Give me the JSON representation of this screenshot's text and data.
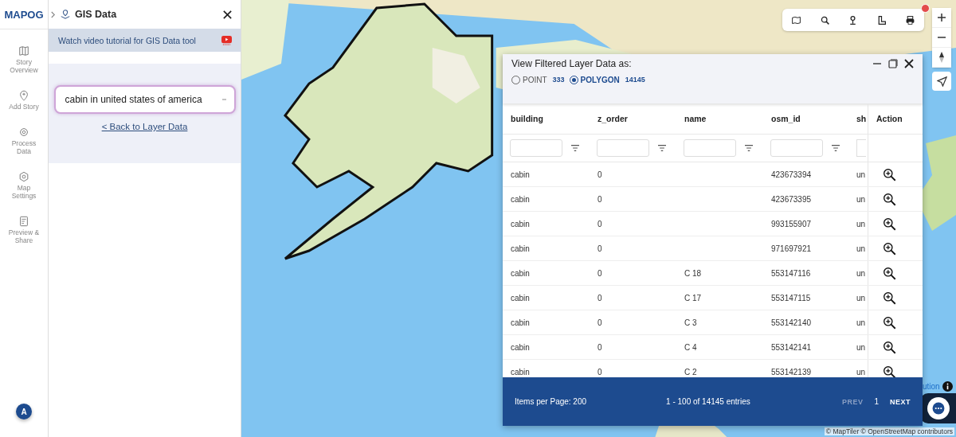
{
  "logo": "MAPOG",
  "rail": {
    "items": [
      {
        "label": "Story Overview"
      },
      {
        "label": "Add Story"
      },
      {
        "label": "Process Data"
      },
      {
        "label": "Map Settings"
      },
      {
        "label": "Preview & Share"
      }
    ],
    "avatar": "A"
  },
  "panel": {
    "title": "GIS Data",
    "tutorial": "Watch video tutorial for GIS Data tool",
    "layer": "cabin in united states of america",
    "back_link": "< Back to Layer Data"
  },
  "data_window": {
    "title": "View Filtered Layer Data as:",
    "options": [
      {
        "label": "POINT",
        "count": "333",
        "selected": false
      },
      {
        "label": "POLYGON",
        "count": "14145",
        "selected": true
      }
    ],
    "columns": [
      "building",
      "z_order",
      "name",
      "osm_id",
      "sh"
    ],
    "action_column": "Action",
    "rows": [
      [
        "cabin",
        "0",
        "",
        "423673394",
        "un"
      ],
      [
        "cabin",
        "0",
        "",
        "423673395",
        "un"
      ],
      [
        "cabin",
        "0",
        "",
        "993155907",
        "un"
      ],
      [
        "cabin",
        "0",
        "",
        "971697921",
        "un"
      ],
      [
        "cabin",
        "0",
        "C 18",
        "553147116",
        "un"
      ],
      [
        "cabin",
        "0",
        "C 17",
        "553147115",
        "un"
      ],
      [
        "cabin",
        "0",
        "C 3",
        "553142140",
        "un"
      ],
      [
        "cabin",
        "0",
        "C 4",
        "553142141",
        "un"
      ],
      [
        "cabin",
        "0",
        "C 2",
        "553142139",
        "un"
      ]
    ],
    "footer": {
      "items_per_page": "Items per Page: 200",
      "range": "1 - 100 of 14145 entries",
      "prev": {
        "label": "PREV",
        "disabled": true
      },
      "page": "1",
      "next": {
        "label": "NEXT",
        "disabled": false
      }
    }
  },
  "map": {
    "attribution_button": "ution",
    "attribution": "© MapTiler © OpenStreetMap contributors",
    "notification": true
  }
}
